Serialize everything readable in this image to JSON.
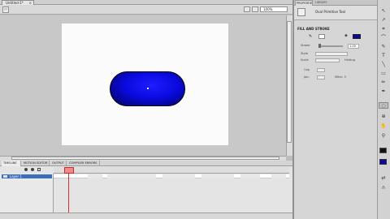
{
  "document": {
    "tab_label": "Untitled-1*",
    "close_glyph": "×"
  },
  "editbar": {
    "back_glyph": "⇦",
    "zoom_value": "100%"
  },
  "timeline": {
    "tabs": [
      "TIMELINE",
      "MOTION EDITOR",
      "OUTPUT",
      "COMPILER ERRORS"
    ],
    "layer_name": "Layer 1"
  },
  "properties": {
    "tabs": [
      "PROPERTIES",
      "LIBRARY"
    ],
    "tool_name": "Oval Primitive Tool",
    "section_title": "FILL AND STROKE",
    "stroke_label": "Stroke",
    "stroke_value": "1.00",
    "style_label": "Style",
    "scale_label": "Scale",
    "hinting_label": "Hinting",
    "cap_label": "Cap",
    "join_label": "Join",
    "miter_label": "Miter: 3",
    "fill_color": "#0a0a9e",
    "stroke_color": "#111111"
  },
  "tools": [
    "↖",
    "↗",
    "⌗",
    "⌒",
    "✎",
    "T",
    "╲",
    "▭",
    "✏",
    "✒",
    "◌",
    "⊕",
    "✋",
    "⚲"
  ],
  "colors": {
    "pill_fill": "#0a0ae0",
    "stage": "#fbfbfb"
  }
}
